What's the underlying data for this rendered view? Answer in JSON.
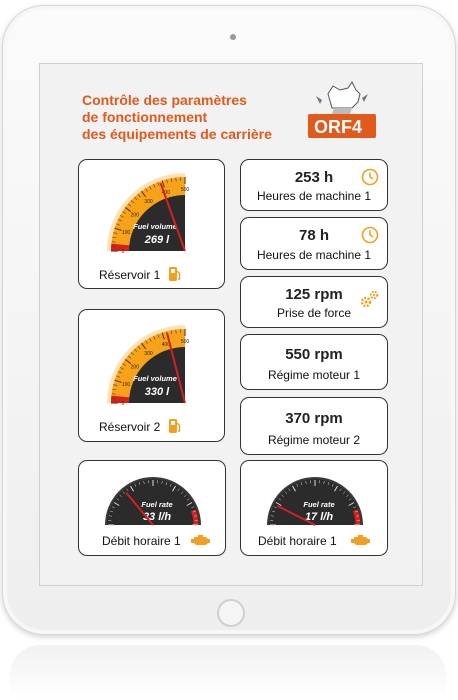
{
  "header": {
    "title_lines": [
      "Contrôle des paramètres",
      "de fonctionnement",
      "des équipements de carrière"
    ],
    "logo_text": "ORF4"
  },
  "tanks": [
    {
      "label": "Réservoir 1",
      "gauge_caption": "Fuel volume",
      "value": "269 l",
      "needle_fraction": 0.78,
      "ticks": [
        "0",
        "100",
        "200",
        "300",
        "400",
        "500"
      ]
    },
    {
      "label": "Réservoir 2",
      "gauge_caption": "Fuel volume",
      "value": "330 l",
      "needle_fraction": 0.84,
      "ticks": [
        "0",
        "100",
        "200",
        "300",
        "400",
        "500"
      ]
    }
  ],
  "rates": [
    {
      "label": "Débit horaire 1",
      "gauge_caption": "Fuel rate",
      "value": "33 l/h",
      "needle_fraction": 0.28
    },
    {
      "label": "Débit horaire 1",
      "gauge_caption": "Fuel rate",
      "value": "17 l/h",
      "needle_fraction": 0.15
    }
  ],
  "stats": [
    {
      "value": "253 h",
      "label": "Heures de machine 1",
      "icon": "clock-icon"
    },
    {
      "value": "78 h",
      "label": "Heures de machine 1",
      "icon": "clock-icon"
    },
    {
      "value": "125 rpm",
      "label": "Prise de force",
      "icon": "gears-icon"
    },
    {
      "value": "550 rpm",
      "label": "Régime moteur 1",
      "icon": ""
    },
    {
      "value": "370 rpm",
      "label": "Régime moteur 2",
      "icon": ""
    }
  ],
  "colors": {
    "accent": "#e05a1c",
    "icon": "#f0a020",
    "gauge_orange": "#f7a21b",
    "gauge_dark": "#2b2b2b",
    "needle": "#d4201f"
  }
}
